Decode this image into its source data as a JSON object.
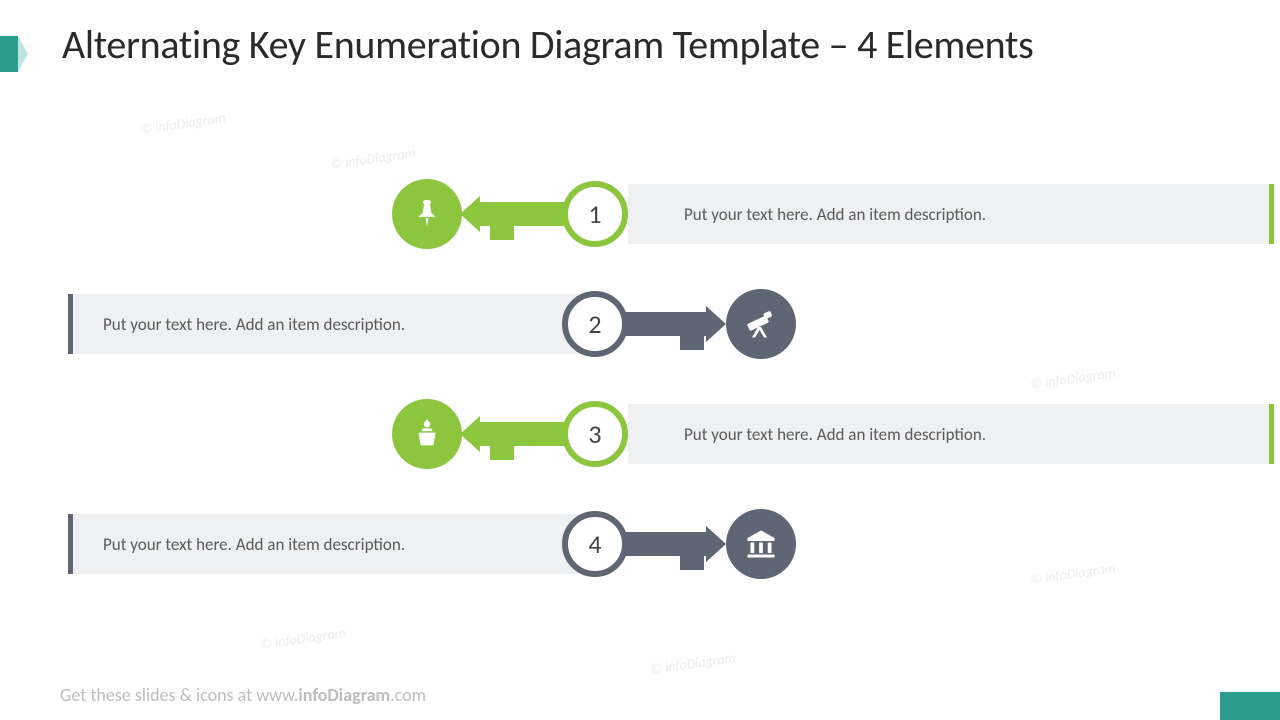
{
  "title": "Alternating Key Enumeration Diagram Template – 4 Elements",
  "footer_pre": "Get these slides & icons at www.",
  "footer_bold": "infoDiagram",
  "footer_post": ".com",
  "watermark": "© infoDiagram",
  "colors": {
    "green": "#8cc63f",
    "grey": "#5e6673",
    "bar": "#eef0f2",
    "teal": "#2a9d8f"
  },
  "items": [
    {
      "num": "1",
      "text": "Put your text here. Add an item description.",
      "side": "right",
      "color": "green",
      "icon": "pushpin-icon"
    },
    {
      "num": "2",
      "text": "Put your text here. Add an item description.",
      "side": "left",
      "color": "grey",
      "icon": "telescope-icon"
    },
    {
      "num": "3",
      "text": "Put your text here. Add an item description.",
      "side": "right",
      "color": "green",
      "icon": "podium-icon"
    },
    {
      "num": "4",
      "text": "Put your text here. Add an item description.",
      "side": "left",
      "color": "grey",
      "icon": "bank-icon"
    }
  ]
}
